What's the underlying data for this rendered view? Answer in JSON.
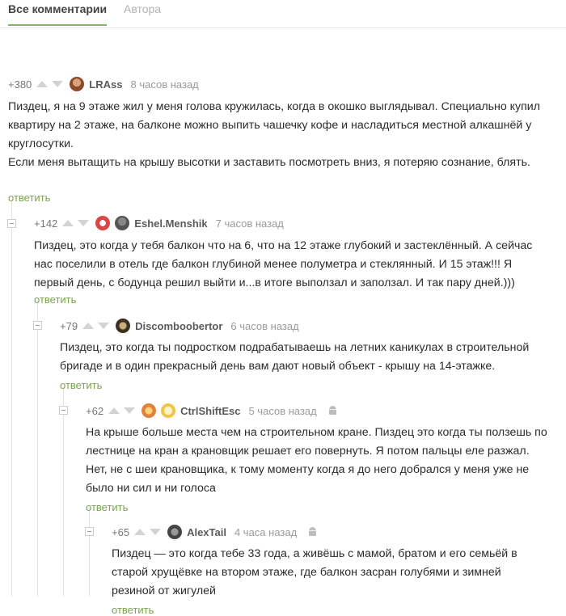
{
  "tabs": {
    "all": "Все комментарии",
    "authors": "Автора"
  },
  "comments": [
    {
      "rating": "+380",
      "author": "LRAss",
      "time": "8 часов назад",
      "text": "Пиздец, я на 9 этаже жил у меня голова кружилась, когда в окошко выглядывал. Специально купил квартиру на 2 этаже, на балконе можно выпить чашечку кофе и насладиться местной алкашнёй у круглосутки.\nЕсли меня вытащить на крышу высотки и заставить посмотреть вниз, я потеряю сознание, блять.",
      "reply": "ответить"
    },
    {
      "rating": "+142",
      "author": "Eshel.Menshik",
      "time": "7 часов назад",
      "text": "Пиздец, это когда у тебя балкон что на 6, что на 12 этаже глубокий и застеклённый. А сейчас нас поселили в отель где балкон глубиной менее полуметра и стеклянный. И 15 этаж!!! Я первый день, с бодунца решил выйти и...в итоге выползал и заползал. И так пару дней.)))",
      "reply": "ответить"
    },
    {
      "rating": "+79",
      "author": "Discomboobertor",
      "time": "6 часов назад",
      "text": "Пиздец, это когда ты подростком подрабатываешь на летних каникулах в строительной бригаде и в один прекрасный день вам дают новый объект - крышу на 14-этажке.",
      "reply": "ответить"
    },
    {
      "rating": "+62",
      "author": "CtrlShiftEsc",
      "time": "5 часов назад",
      "text": "На крыше больше места чем на строительном кране. Пиздец это когда ты ползешь по лестнице на кран а крановщик решает его повернуть. Я потом пальцы еле разжал. Нет, не с шеи крановщика, к тому моменту когда я до него добрался у меня уже не было ни сил и ни голоса",
      "reply": "ответить"
    },
    {
      "rating": "+65",
      "author": "AlexTail",
      "time": "4 часа назад",
      "text": "Пиздец — это когда тебе 33 года, а живёшь с мамой, братом и его семьёй в старой хрущёвке на втором этаже, где балкон засран голубями и зимней резиной от жигулей",
      "reply": "ответить"
    }
  ],
  "icons": {
    "vote_up": "arrow-up-icon",
    "vote_down": "arrow-down-icon",
    "mobile": "android-icon"
  },
  "colors": {
    "accent": "#8ab35a",
    "reply": "#7aa44a",
    "meta": "#9a9a9a"
  }
}
